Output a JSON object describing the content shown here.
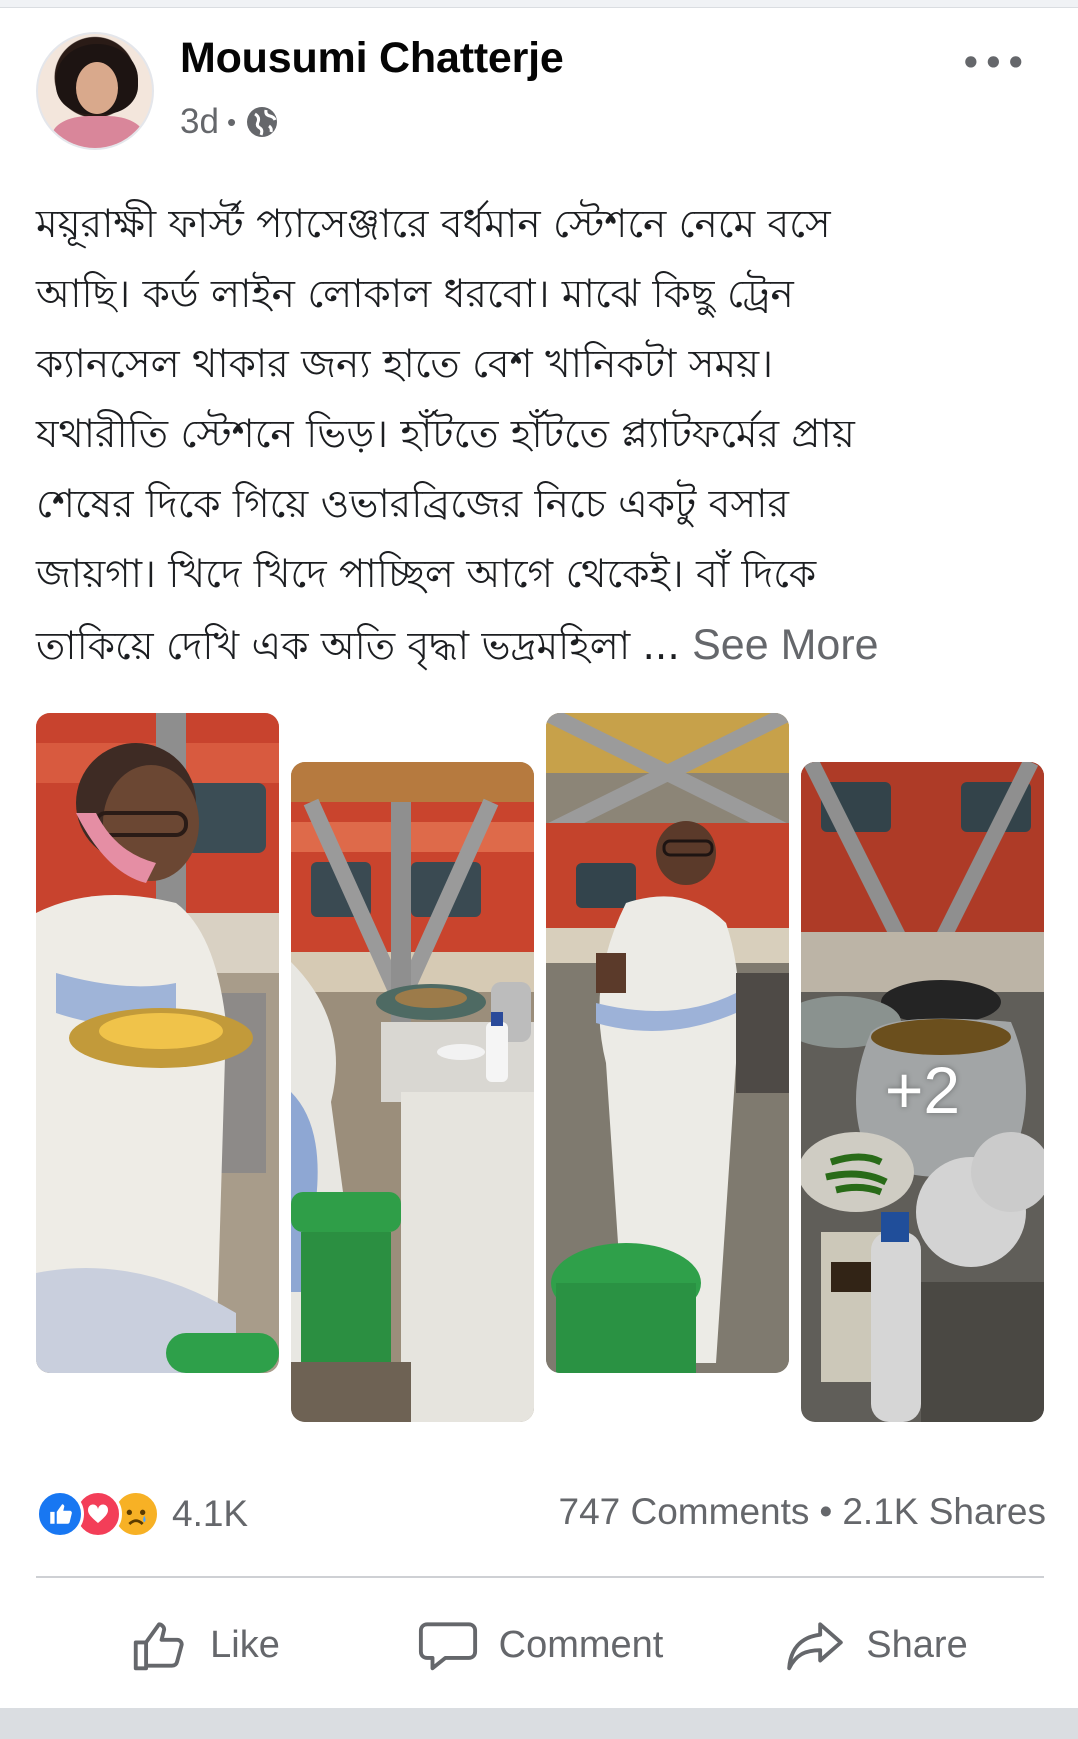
{
  "post": {
    "author": "Mousumi Chatterje",
    "time": "3d",
    "separator": "•",
    "privacy_icon": "globe-icon",
    "more_icon": "•••",
    "text_lines": [
      "ময়ূরাক্ষী ফার্স্ট প্যাসেঞ্জারে বর্ধমান স্টেশনে নেমে বসে",
      "আছি। কর্ড লাইন লোকাল ধরবো। মাঝে কিছু ট্রেন",
      "ক্যানসেল থাকার জন্য হাতে বেশ খানিকটা সময়।",
      "যথারীতি স্টেশনে ভিড়। হাঁটতে হাঁটতে প্ল্যাটফর্মের প্রায়",
      "শেষের দিকে গিয়ে ওভারব্রিজের নিচে একটু বসার",
      "জায়গা।  খিদে খিদে পাচ্ছিল আগে থেকেই। বাঁ দিকে",
      "তাকিয়ে দেখি এক অতি বৃদ্ধা ভদ্রমহিলা ... "
    ],
    "see_more": "See More",
    "extra_photos": "+2"
  },
  "stats": {
    "reactions": [
      "like-icon",
      "love-icon",
      "sad-icon"
    ],
    "reaction_count": "4.1K",
    "comments": "747 Comments",
    "dot": "•",
    "shares": "2.1K Shares"
  },
  "actions": {
    "like": "Like",
    "comment": "Comment",
    "share": "Share"
  },
  "colors": {
    "like_blue": "#1877f2",
    "love_red": "#f33e58",
    "sad_yellow": "#f7b125",
    "secondary_text": "#65676b"
  }
}
